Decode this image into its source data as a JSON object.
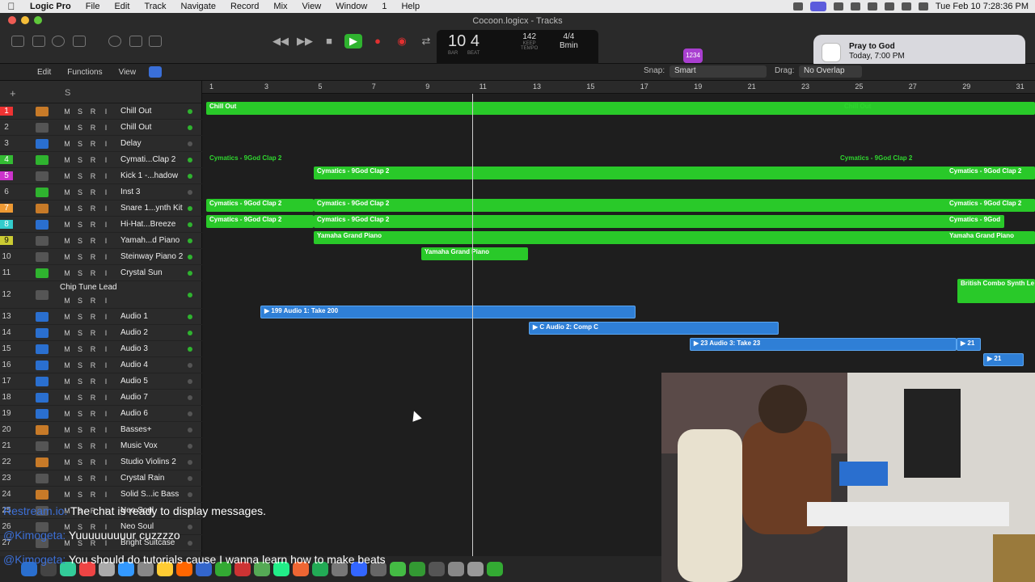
{
  "menubar": {
    "app": "Logic Pro",
    "items": [
      "File",
      "Edit",
      "Track",
      "Navigate",
      "Record",
      "Mix",
      "View",
      "Window",
      "1",
      "Help"
    ],
    "datetime": "Tue Feb 10  7:28:36 PM"
  },
  "window": {
    "title": "Cocoon.logicx - Tracks"
  },
  "lcd": {
    "bar": "10",
    "beat": "4",
    "bar_label": "BAR",
    "beat_label": "BEAT",
    "tempo": "142",
    "tempo_label": "KEEP",
    "tempo_sub": "TEMPO",
    "sig": "4/4",
    "key": "Bmin"
  },
  "badge": "1234",
  "notification": {
    "title": "Pray to God",
    "subtitle": "Today, 7:00 PM"
  },
  "editbar": {
    "edit": "Edit",
    "functions": "Functions",
    "view": "View",
    "snap_label": "Snap:",
    "snap_value": "Smart",
    "drag_label": "Drag:",
    "drag_value": "No Overlap"
  },
  "trackheader": {
    "s": "S",
    "plus": "+"
  },
  "tracks": [
    {
      "num": "1",
      "color": "r",
      "name": "Chill Out",
      "icon": "orange",
      "dot": true
    },
    {
      "num": "2",
      "color": "",
      "name": "Chill Out",
      "icon": "",
      "dot": true
    },
    {
      "num": "3",
      "color": "",
      "name": "Delay",
      "icon": "blue",
      "dot": false
    },
    {
      "num": "4",
      "color": "g",
      "name": "Cymati...Clap 2",
      "icon": "green",
      "dot": true
    },
    {
      "num": "5",
      "color": "m",
      "name": "Kick 1 -...hadow",
      "icon": "",
      "dot": true
    },
    {
      "num": "6",
      "color": "",
      "name": "Inst 3",
      "icon": "green",
      "dot": false
    },
    {
      "num": "7",
      "color": "o",
      "name": "Snare 1...ynth Kit",
      "icon": "orange",
      "dot": true
    },
    {
      "num": "8",
      "color": "c",
      "name": "Hi-Hat...Breeze",
      "icon": "blue",
      "dot": true
    },
    {
      "num": "9",
      "color": "y",
      "name": "Yamah...d Piano",
      "icon": "",
      "dot": true
    },
    {
      "num": "10",
      "color": "",
      "name": "Steinway Piano 2",
      "icon": "",
      "dot": true
    },
    {
      "num": "11",
      "color": "",
      "name": "Crystal Sun",
      "icon": "green",
      "dot": true
    },
    {
      "num": "12",
      "color": "",
      "name": "Chip Tune Lead",
      "icon": "",
      "dot": true
    },
    {
      "num": "13",
      "color": "",
      "name": "Audio 1",
      "icon": "blue",
      "dot": true
    },
    {
      "num": "14",
      "color": "",
      "name": "Audio 2",
      "icon": "blue",
      "dot": true
    },
    {
      "num": "15",
      "color": "",
      "name": "Audio 3",
      "icon": "blue",
      "dot": true
    },
    {
      "num": "16",
      "color": "",
      "name": "Audio 4",
      "icon": "blue",
      "dot": false
    },
    {
      "num": "17",
      "color": "",
      "name": "Audio 5",
      "icon": "blue",
      "dot": false
    },
    {
      "num": "18",
      "color": "",
      "name": "Audio 7",
      "icon": "blue",
      "dot": false
    },
    {
      "num": "19",
      "color": "",
      "name": "Audio 6",
      "icon": "blue",
      "dot": false
    },
    {
      "num": "20",
      "color": "",
      "name": "Basses+",
      "icon": "orange",
      "dot": false
    },
    {
      "num": "21",
      "color": "",
      "name": "Music Vox",
      "icon": "",
      "dot": false
    },
    {
      "num": "22",
      "color": "",
      "name": "Studio Violins 2",
      "icon": "orange",
      "dot": false
    },
    {
      "num": "23",
      "color": "",
      "name": "Crystal Rain",
      "icon": "",
      "dot": false
    },
    {
      "num": "24",
      "color": "",
      "name": "Solid S...ic Bass",
      "icon": "orange",
      "dot": false
    },
    {
      "num": "25",
      "color": "",
      "name": "Neo Soul",
      "icon": "",
      "dot": false
    },
    {
      "num": "26",
      "color": "",
      "name": "Neo Soul",
      "icon": "",
      "dot": false
    },
    {
      "num": "27",
      "color": "",
      "name": "Bright Suitcase",
      "icon": "",
      "dot": false
    }
  ],
  "track_buttons": [
    "M",
    "S",
    "R",
    "I"
  ],
  "ruler": [
    "1",
    "3",
    "5",
    "7",
    "9",
    "11",
    "13",
    "15",
    "17",
    "19",
    "21",
    "23",
    "25",
    "27",
    "29",
    "31"
  ],
  "regions": [
    {
      "text": "Chill Out",
      "type": "green"
    },
    {
      "text": "Chill Out",
      "type": "label"
    },
    {
      "text": "Cymatics - 9God Clap 2",
      "type": "label"
    },
    {
      "text": "Cymatics - 9God Clap 2",
      "type": "label"
    },
    {
      "text": "Cymatics - 9God Clap 2",
      "type": "green"
    },
    {
      "text": "Cymatics - 9God Clap 2",
      "type": "green"
    },
    {
      "text": "Cymatics - 9God Clap 2",
      "type": "green"
    },
    {
      "text": "Cymatics - 9God Clap 2",
      "type": "green"
    },
    {
      "text": "Cymatics - 9God Clap 2",
      "type": "green"
    },
    {
      "text": "Cymatics - 9God Clap 2",
      "type": "green"
    },
    {
      "text": "Cymatics - 9God Clap 2",
      "type": "green"
    },
    {
      "text": "Cymatics - 9God",
      "type": "green"
    },
    {
      "text": "Yamaha Grand Piano",
      "type": "green"
    },
    {
      "text": "Yamaha Grand Piano",
      "type": "green"
    },
    {
      "text": "Yamaha Grand Piano",
      "type": "green"
    },
    {
      "text": "British Combo Synth Le",
      "type": "green"
    },
    {
      "text": "▶  199   Audio 1: Take 200",
      "type": "blue"
    },
    {
      "text": "▶  C   Audio 2: Comp C",
      "type": "blue"
    },
    {
      "text": "▶  23   Audio 3: Take 23",
      "type": "blue"
    },
    {
      "text": "▶  21",
      "type": "blue"
    },
    {
      "text": "▶  21",
      "type": "blue"
    }
  ],
  "chat": [
    {
      "user": "Restream.io:",
      "msg": " The chat is ready to display messages."
    },
    {
      "user": "@Kimogeta:",
      "msg": " Yuuuuuuuuur cuzzzzo"
    },
    {
      "user": "@Kimogeta:",
      "msg": " You should do tutorials cause I wanna learn how to make beats"
    }
  ]
}
